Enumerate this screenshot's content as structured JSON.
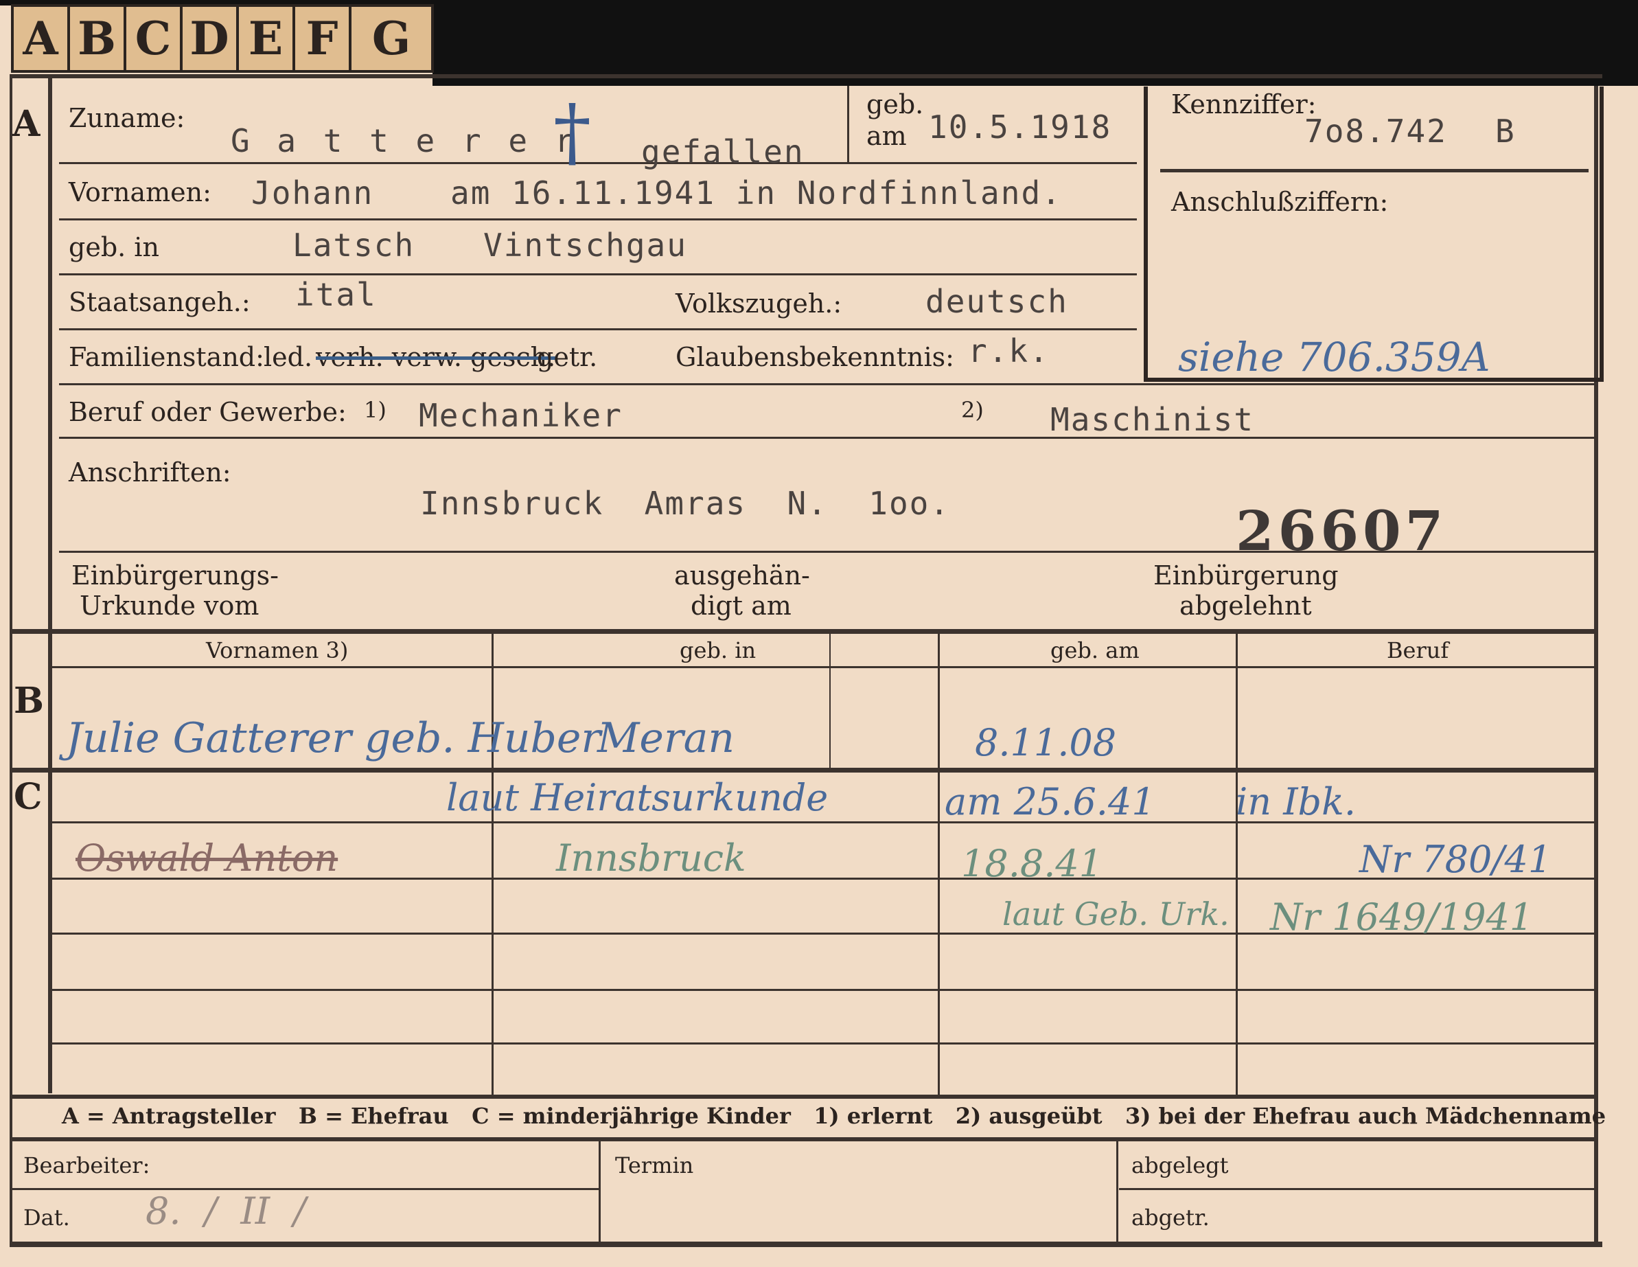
{
  "tabs": [
    "A",
    "B",
    "C",
    "D",
    "E",
    "F",
    "G"
  ],
  "sections": {
    "a": "A",
    "b": "B",
    "c": "C"
  },
  "section_a": {
    "zuname_label": "Zuname:",
    "zuname_value": "G a t t e r e r",
    "cross_symbol": "†",
    "gefallen": "gefallen",
    "geb_label": "geb.",
    "am_label": "am",
    "geb_date": "10.5.1918",
    "vornamen_label": "Vornamen:",
    "vornamen_value": "Johann",
    "death_note": "am 16.11.1941 in Nordfinnland.",
    "gebin_label": "geb. in",
    "gebin_town": "Latsch",
    "gebin_region": "Vintschgau",
    "staats_label": "Staatsangeh.:",
    "staats_value": "ital",
    "volks_label": "Volkszugeh.:",
    "volks_value": "deutsch",
    "familien_label": "Familienstand:",
    "familien_options": "led.",
    "familien_struck": "verh. verw. gesch.",
    "familien_tail": "getr.",
    "glaubens_label": "Glaubensbekenntnis:",
    "glaubens_value": "r.k.",
    "beruf_label": "Beruf oder Gewerbe:",
    "beruf_n1": "1)",
    "beruf_value1": "Mechaniker",
    "beruf_n2": "2)",
    "beruf_value2": "Maschinist",
    "anschriften_label": "Anschriften:",
    "address": "Innsbruck  Amras  N.  1oo.",
    "stamp_number": "26607",
    "einb_urkunde_l1": "Einbürgerungs-",
    "einb_urkunde_l2": "Urkunde vom",
    "ausgeh_l1": "ausgehän-",
    "ausgeh_l2": "digt am",
    "einb_abgelehnt_l1": "Einbürgerung",
    "einb_abgelehnt_l2": "abgelehnt"
  },
  "kennziffer": {
    "label": "Kennziffer:",
    "value": "7o8.742",
    "suffix": "B",
    "anschluss_label": "Anschlußziffern:",
    "siehe_note": "siehe 706.359A"
  },
  "table": {
    "headers": [
      "Vornamen 3)",
      "geb. in",
      "geb. am",
      "Beruf"
    ],
    "b_row": {
      "name": "Julie Gatterer geb. Huber",
      "place": "Meran",
      "date": "8.11.08"
    },
    "c_rows": [
      {
        "name": "",
        "place": "laut Heiratsurkunde",
        "date": "am 25.6.41",
        "beruf": "in Ibk."
      },
      {
        "name": "Oswald Anton",
        "place": "Innsbruck",
        "date": "18.8.41",
        "beruf": "Nr 780/41"
      },
      {
        "name": "",
        "place": "",
        "date": "laut Geb. Urk.",
        "beruf": "Nr 1649/1941"
      }
    ]
  },
  "legend": "A = Antragsteller   B = Ehefrau   C = minderjährige Kinder   1) erlernt   2) ausgeübt   3) bei der Ehefrau auch Mädchenname",
  "footer": {
    "bearbeiter_label": "Bearbeiter:",
    "termin_label": "Termin",
    "abgelegt_label": "abgelegt",
    "dat_label": "Dat.",
    "dat_value": "8.  /  II  /",
    "abgetr_label": "abgetr."
  }
}
